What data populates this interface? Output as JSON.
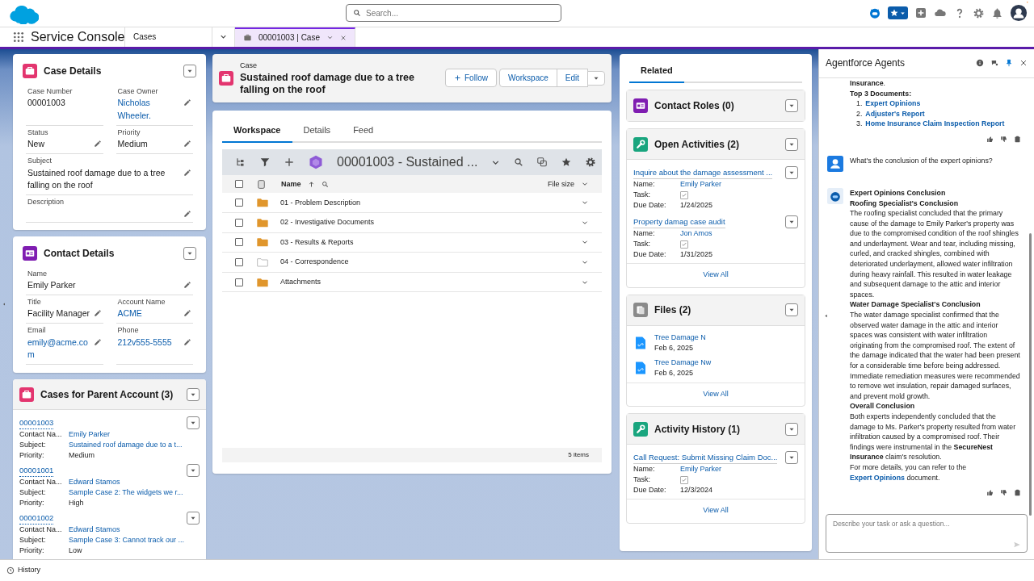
{
  "header": {
    "search": {
      "placeholder": "Search..."
    }
  },
  "nav": {
    "app_name": "Service Console",
    "tabs": [
      {
        "label": "Cases",
        "selected": false,
        "kind": "object"
      },
      {
        "label": "00001003 | Case",
        "selected": true,
        "kind": "record"
      }
    ]
  },
  "case_details": {
    "title": "Case Details",
    "rows": [
      [
        {
          "label": "Case Number",
          "value": "00001003",
          "link": false,
          "editable": false
        },
        {
          "label": "Case Owner",
          "value": "Nicholas Wheeler.",
          "link": true,
          "editable": true
        }
      ],
      [
        {
          "label": "Status",
          "value": "New",
          "link": false,
          "editable": true
        },
        {
          "label": "Priority",
          "value": "Medium",
          "link": false,
          "editable": true
        }
      ],
      [
        {
          "label": "Subject",
          "value": "Sustained roof damage due to a tree falling on the roof",
          "link": false,
          "editable": true
        }
      ],
      [
        {
          "label": "Description",
          "editable": true
        }
      ]
    ]
  },
  "contact_details": {
    "title": "Contact Details",
    "rows": [
      [
        {
          "label": "Name",
          "value": "Emily Parker",
          "link": false,
          "editable": true
        }
      ],
      [
        {
          "label": "Title",
          "value": "Facility Manager",
          "link": false,
          "editable": true
        },
        {
          "label": "Account Name",
          "value": "ACME",
          "link": true,
          "editable": true
        }
      ],
      [
        {
          "label": "Email",
          "value": "emily@acme.com",
          "link": true,
          "editable": true
        },
        {
          "label": "Phone",
          "value": "212v555-5555",
          "link": true,
          "editable": true
        }
      ]
    ]
  },
  "parent_cases": {
    "title": "Cases for Parent Account (3)",
    "items": [
      {
        "number": "00001003",
        "fields": [
          {
            "label": "Contact Na...",
            "value": "Emily Parker",
            "link": true
          },
          {
            "label": "Subject:",
            "value": "Sustained roof damage due to a t...",
            "link": true
          },
          {
            "label": "Priority:",
            "value": "Medium",
            "link": false
          }
        ]
      },
      {
        "number": "00001001",
        "fields": [
          {
            "label": "Contact Na...",
            "value": "Edward Stamos",
            "link": true
          },
          {
            "label": "Subject:",
            "value": "Sample Case 2: The widgets we r...",
            "link": true
          },
          {
            "label": "Priority:",
            "value": "High",
            "link": false
          }
        ]
      },
      {
        "number": "00001002",
        "fields": [
          {
            "label": "Contact Na...",
            "value": "Edward Stamos",
            "link": true
          },
          {
            "label": "Subject:",
            "value": "Sample Case 3: Cannot track our ...",
            "link": true
          },
          {
            "label": "Priority:",
            "value": "Low",
            "link": false
          }
        ]
      }
    ]
  },
  "record": {
    "type": "Case",
    "title": "Sustained roof damage due to a tree falling on the roof",
    "buttons": [
      {
        "label": "Follow",
        "kind": "follow"
      },
      {
        "label": "Workspace",
        "kind": "plain"
      },
      {
        "label": "Edit",
        "kind": "plain"
      }
    ]
  },
  "record_tabs": [
    {
      "label": "Workspace",
      "selected": true
    },
    {
      "label": "Details",
      "selected": false
    },
    {
      "label": "Feed",
      "selected": false
    }
  ],
  "workspace": {
    "title": "00001003 - Sustained ...",
    "columns": [
      "Name",
      "File size"
    ],
    "rows": [
      {
        "name": "01 - Problem Description",
        "kind": "folder",
        "checked": false
      },
      {
        "name": "02 - Investigative Documents",
        "kind": "folder",
        "checked": false
      },
      {
        "name": "03 - Results & Reports",
        "kind": "folder",
        "checked": false
      },
      {
        "name": "04 - Correspondence",
        "kind": "empty-folder",
        "checked": false
      },
      {
        "name": "Attachments",
        "kind": "folder",
        "checked": false
      }
    ],
    "select_all_checked": false,
    "footer": "5 items"
  },
  "related": {
    "tab": "Related",
    "sections": [
      {
        "title": "Contact Roles (0)",
        "kind": "contact"
      },
      {
        "title": "Open Activities (2)",
        "kind": "activity",
        "items": [
          {
            "title": "Inquire about the damage assessment ...",
            "fields": [
              {
                "label": "Name:",
                "kind": "link",
                "value": "Emily Parker"
              },
              {
                "label": "Task:",
                "kind": "check",
                "checked": true
              },
              {
                "label": "Due Date:",
                "kind": "text",
                "value": "1/24/2025"
              }
            ]
          },
          {
            "title": "Property damag case audit",
            "fields": [
              {
                "label": "Name:",
                "kind": "link",
                "value": "Jon Amos"
              },
              {
                "label": "Task:",
                "kind": "check",
                "checked": true
              },
              {
                "label": "Due Date:",
                "kind": "text",
                "value": "1/31/2025"
              }
            ]
          }
        ],
        "view_all": "View All"
      },
      {
        "title": "Files (2)",
        "kind": "files",
        "files": [
          {
            "name": "Tree Damage N",
            "date": "Feb 6, 2025"
          },
          {
            "name": "Tree Damage Nw",
            "date": "Feb 6, 2025"
          }
        ],
        "view_all": "View All"
      },
      {
        "title": "Activity History (1)",
        "kind": "activity",
        "items": [
          {
            "title": "Call Request: Submit Missing Claim Doc...",
            "fields": [
              {
                "label": "Name:",
                "kind": "link",
                "value": "Emily Parker"
              },
              {
                "label": "Task:",
                "kind": "check",
                "checked": true
              },
              {
                "label": "Due Date:",
                "kind": "text",
                "value": "12/3/2024"
              }
            ]
          }
        ],
        "view_all": "View All"
      }
    ]
  },
  "agent_panel": {
    "title": "Agentforce Agents",
    "messages": [
      {
        "kind": "agent",
        "avatar": false,
        "blocks": [
          {
            "kind": "text",
            "text": "**Insurance**."
          },
          {
            "kind": "heading",
            "text": "Top 3 Documents:"
          },
          {
            "kind": "list",
            "items": [
              {
                "number": "1.",
                "text": "Expert Opinions"
              },
              {
                "number": "2.",
                "text": "Adjuster's Report"
              },
              {
                "number": "3.",
                "text": "Home Insurance Claim Inspection Report"
              }
            ]
          }
        ]
      },
      {
        "kind": "user",
        "text": "What's the conclusion of the expert opinions?"
      },
      {
        "kind": "agent",
        "avatar": true,
        "blocks": [
          {
            "kind": "heading",
            "text": "Expert Opinions Conclusion"
          },
          {
            "kind": "heading",
            "text": "Roofing Specialist's Conclusion"
          },
          {
            "kind": "text",
            "text": "The roofing specialist concluded that the primary cause of the damage to Emily Parker's property was due to the compromised condition of the roof shingles and underlayment. Wear and tear, including missing, curled, and cracked shingles, combined with deteriorated underlayment, allowed water infiltration during heavy rainfall. This resulted in water leakage and subsequent damage to the attic and interior spaces."
          },
          {
            "kind": "heading",
            "text": "Water Damage Specialist's Conclusion"
          },
          {
            "kind": "text",
            "text": "The water damage specialist confirmed that the observed water damage in the attic and interior spaces was consistent with water infiltration originating from the compromised roof. The extent of the damage indicated that the water had been present for a considerable time before being addressed. Immediate remediation measures were recommended to remove wet insulation, repair damaged surfaces, and prevent mold growth."
          },
          {
            "kind": "heading",
            "text": "Overall Conclusion"
          },
          {
            "kind": "text",
            "text": "Both experts independently concluded that the damage to Ms. Parker's property resulted from water infiltration caused by a compromised roof. Their findings were instrumental in the **SecureNest Insurance** claim's resolution."
          },
          {
            "kind": "text",
            "text": "For more details, you can refer to the",
            "link": "Expert Opinions",
            "after": "document."
          }
        ]
      }
    ],
    "input": {
      "placeholder": "Describe your task or ask a question..."
    }
  },
  "footer": {
    "label": "History"
  }
}
